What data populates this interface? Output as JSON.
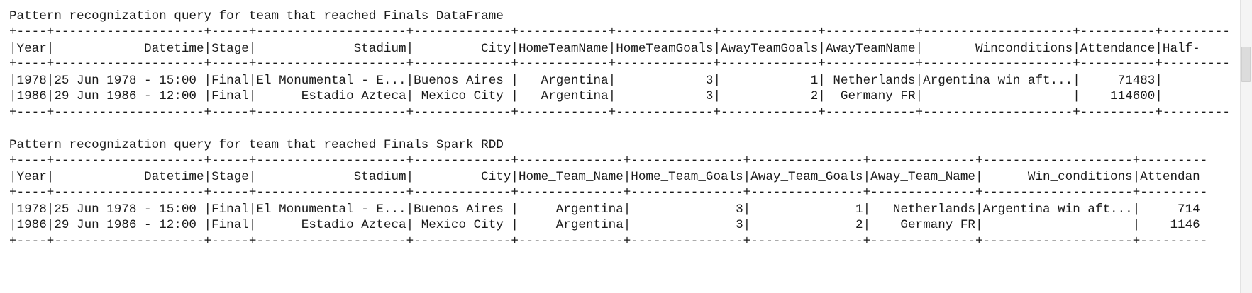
{
  "output": {
    "dataframe_section": {
      "title": "Pattern recognization query for team that reached Finals DataFrame",
      "border_top": "+----+--------------------+-----+--------------------+-------------+------------+-------------+-------------+------------+--------------------+----------+---------",
      "header": "|Year|            Datetime|Stage|             Stadium|         City|HomeTeamName|HomeTeamGoals|AwayTeamGoals|AwayTeamName|       Winconditions|Attendance|Half-",
      "border_mid": "+----+--------------------+-----+--------------------+-------------+------------+-------------+-------------+------------+--------------------+----------+---------",
      "rows": [
        "|1978|25 Jun 1978 - 15:00 |Final|El Monumental - E...|Buenos Aires |   Argentina|            3|            1| Netherlands|Argentina win aft...|     71483|",
        "|1986|29 Jun 1986 - 12:00 |Final|      Estadio Azteca| Mexico City |   Argentina|            3|            2|  Germany FR|                    |    114600|"
      ],
      "border_bottom": "+----+--------------------+-----+--------------------+-------------+------------+-------------+-------------+------------+--------------------+----------+---------"
    },
    "rdd_section": {
      "title": "Pattern recognization query for team that reached Finals Spark RDD",
      "border_top": "+----+--------------------+-----+--------------------+-------------+--------------+---------------+---------------+--------------+--------------------+---------",
      "header": "|Year|            Datetime|Stage|             Stadium|         City|Home_Team_Name|Home_Team_Goals|Away_Team_Goals|Away_Team_Name|      Win_conditions|Attendan",
      "border_mid": "+----+--------------------+-----+--------------------+-------------+--------------+---------------+---------------+--------------+--------------------+---------",
      "rows": [
        "|1978|25 Jun 1978 - 15:00 |Final|El Monumental - E...|Buenos Aires |     Argentina|              3|              1|   Netherlands|Argentina win aft...|     714",
        "|1986|29 Jun 1986 - 12:00 |Final|      Estadio Azteca| Mexico City |     Argentina|              3|              2|    Germany FR|                    |    1146"
      ],
      "border_bottom": "+----+--------------------+-----+--------------------+-------------+--------------+---------------+---------------+--------------+--------------------+---------"
    }
  }
}
